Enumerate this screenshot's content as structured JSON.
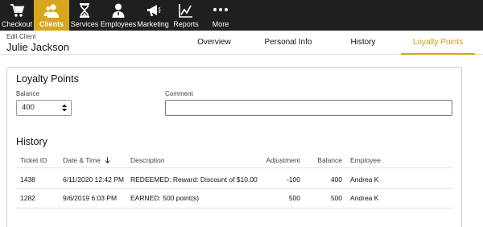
{
  "nav": {
    "items": [
      {
        "label": "Checkout",
        "icon": "cart-icon"
      },
      {
        "label": "Clients",
        "icon": "clients-icon"
      },
      {
        "label": "Services",
        "icon": "hourglass-icon"
      },
      {
        "label": "Employees",
        "icon": "employee-icon"
      },
      {
        "label": "Marketing",
        "icon": "megaphone-icon"
      },
      {
        "label": "Reports",
        "icon": "chart-icon"
      },
      {
        "label": "More",
        "icon": "more-dots-icon"
      }
    ],
    "active_color": "#d6a71e",
    "bg_color": "#1f1f1f"
  },
  "header": {
    "edit_label": "Edit Client",
    "client_name": "Julie Jackson",
    "tabs": [
      "Overview",
      "Personal Info",
      "History",
      "Loyalty Points"
    ],
    "active_tab": "Loyalty Points"
  },
  "loyalty": {
    "title": "Loyalty Points",
    "balance_label": "Balance",
    "balance_value": "400",
    "comment_label": "Comment",
    "comment_value": ""
  },
  "history": {
    "title": "History",
    "columns": [
      "Ticket ID",
      "Date & Time",
      "Description",
      "Adjustment",
      "Balance",
      "Employee"
    ],
    "sort_icon": "arrow-down-icon",
    "rows": [
      [
        "1438",
        "6/11/2020 12:42 PM",
        "REDEEMED: Reward: Discount of $10.00",
        "-100",
        "400",
        "Andrea K"
      ],
      [
        "1282",
        "9/6/2019 6:03 PM",
        "EARNED: 500 point(s)",
        "500",
        "500",
        "Andrea K"
      ]
    ]
  }
}
